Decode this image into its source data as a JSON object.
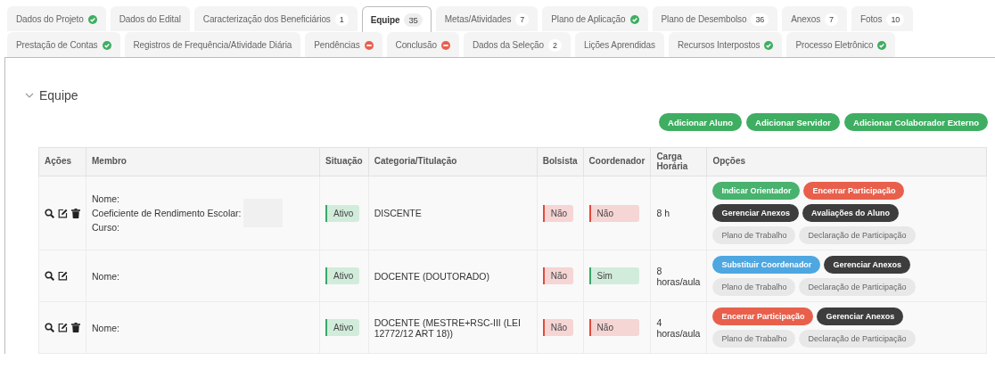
{
  "tabs": [
    [
      {
        "label": "Dados do Projeto",
        "kind": "complete",
        "selected": false
      },
      {
        "label": "Dados do Edital",
        "kind": "plain",
        "selected": false
      },
      {
        "label": "Caracterização dos Beneficiários",
        "count": "1",
        "kind": "plain",
        "selected": false
      },
      {
        "label": "Equipe",
        "count": "35",
        "kind": "plain",
        "selected": true
      },
      {
        "label": "Metas/Atividades",
        "count": "7",
        "kind": "plain",
        "selected": false
      },
      {
        "label": "Plano de Aplicação",
        "kind": "complete",
        "selected": false
      },
      {
        "label": "Plano de Desembolso",
        "count": "36",
        "kind": "plain",
        "selected": false
      },
      {
        "label": "Anexos",
        "count": "7",
        "kind": "plain",
        "selected": false
      },
      {
        "label": "Fotos",
        "count": "10",
        "kind": "plain",
        "selected": false
      }
    ],
    [
      {
        "label": "Prestação de Contas",
        "kind": "complete",
        "selected": false
      },
      {
        "label": "Registros de Frequência/Atividade Diária",
        "kind": "plain",
        "selected": false
      },
      {
        "label": "Pendências",
        "kind": "blocked",
        "selected": false
      },
      {
        "label": "Conclusão",
        "kind": "blocked",
        "selected": false
      },
      {
        "label": "Dados da Seleção",
        "count": "2",
        "kind": "plain",
        "selected": false
      },
      {
        "label": "Lições Aprendidas",
        "kind": "plain",
        "selected": false
      },
      {
        "label": "Recursos Interpostos",
        "kind": "complete",
        "selected": false
      },
      {
        "label": "Processo Eletrônico",
        "kind": "complete",
        "selected": false
      }
    ]
  ],
  "section": {
    "title": "Equipe",
    "expanded": true,
    "buttons": [
      "Adicionar Aluno",
      "Adicionar Servidor",
      "Adicionar Colaborador Externo"
    ],
    "table": {
      "columns": [
        "Ações",
        "Membro",
        "Situação",
        "Categoria/Titulação",
        "Bolsista",
        "Coordenador",
        "Carga Horária",
        "Opções"
      ],
      "rows": [
        {
          "actions": [
            {
              "kind": "view"
            },
            {
              "kind": "edit"
            },
            {
              "kind": "delete"
            }
          ],
          "member": [
            {
              "label": "Nome:",
              "redacted": false
            },
            {
              "label": "Coeficiente de Rendimento Escolar:",
              "redacted": true
            },
            {
              "label": "Curso:",
              "redacted": false
            }
          ],
          "situation": {
            "text": "Ativo",
            "kind": "positive"
          },
          "category": "DISCENTE",
          "scholarship": {
            "text": "Não",
            "kind": "negative"
          },
          "coordinator": {
            "text": "Não",
            "kind": "negative"
          },
          "workload": "8 h",
          "options": [
            {
              "label": "Indicar Orientador",
              "kind": "success"
            },
            {
              "label": "Encerrar Participação",
              "kind": "danger"
            },
            {
              "label": "Gerenciar Anexos",
              "kind": "dark"
            },
            {
              "label": "Avaliações do Aluno",
              "kind": "dark"
            },
            {
              "label": "Plano de Trabalho",
              "kind": "light"
            },
            {
              "label": "Declaração de Participação",
              "kind": "light"
            }
          ]
        },
        {
          "actions": [
            {
              "kind": "view"
            },
            {
              "kind": "edit"
            }
          ],
          "member": [
            {
              "label": "Nome:",
              "redacted": false
            }
          ],
          "situation": {
            "text": "Ativo",
            "kind": "positive"
          },
          "category": "DOCENTE (DOUTORADO)",
          "scholarship": {
            "text": "Não",
            "kind": "negative"
          },
          "coordinator": {
            "text": "Sim",
            "kind": "positive"
          },
          "workload": "8 horas/aula",
          "options": [
            {
              "label": "Substituir Coordenador",
              "kind": "info"
            },
            {
              "label": "Gerenciar Anexos",
              "kind": "dark"
            },
            {
              "label": "Plano de Trabalho",
              "kind": "light"
            },
            {
              "label": "Declaração de Participação",
              "kind": "light"
            }
          ]
        },
        {
          "actions": [
            {
              "kind": "view"
            },
            {
              "kind": "edit"
            },
            {
              "kind": "delete"
            }
          ],
          "member": [
            {
              "label": "Nome:",
              "redacted": false
            }
          ],
          "situation": {
            "text": "Ativo",
            "kind": "positive"
          },
          "category": "DOCENTE (MESTRE+RSC-III (LEI 12772/12 ART 18))",
          "scholarship": {
            "text": "Não",
            "kind": "negative"
          },
          "coordinator": {
            "text": "Não",
            "kind": "negative"
          },
          "workload": "4 horas/aula",
          "options": [
            {
              "label": "Encerrar Participação",
              "kind": "danger"
            },
            {
              "label": "Gerenciar Anexos",
              "kind": "dark"
            },
            {
              "label": "Plano de Trabalho",
              "kind": "light"
            },
            {
              "label": "Declaração de Participação",
              "kind": "light"
            }
          ]
        }
      ]
    }
  }
}
